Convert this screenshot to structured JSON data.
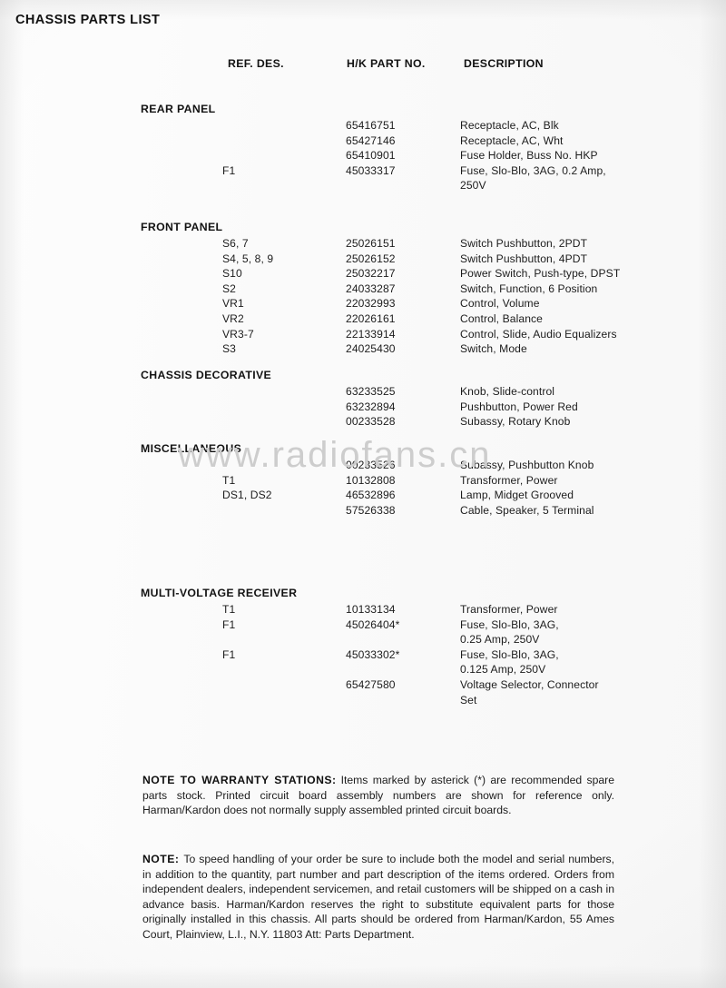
{
  "document": {
    "title": "CHASSIS PARTS LIST",
    "watermark": "www.radiofans.cn"
  },
  "table": {
    "headers": {
      "ref_des": "REF. DES.",
      "part_no": "H/K PART NO.",
      "description": "DESCRIPTION"
    },
    "sections": [
      {
        "name": "REAR PANEL",
        "rows": [
          {
            "ref": "",
            "part": "65416751",
            "desc": "Receptacle, AC, Blk"
          },
          {
            "ref": "",
            "part": "65427146",
            "desc": "Receptacle, AC, Wht"
          },
          {
            "ref": "",
            "part": "65410901",
            "desc": "Fuse Holder, Buss No. HKP"
          },
          {
            "ref": "F1",
            "part": "45033317",
            "desc": "Fuse, Slo-Blo, 3AG, 0.2 Amp,"
          },
          {
            "ref": "",
            "part": "",
            "desc": "250V"
          }
        ]
      },
      {
        "name": "FRONT PANEL",
        "rows": [
          {
            "ref": "S6, 7",
            "part": "25026151",
            "desc": "Switch Pushbutton, 2PDT"
          },
          {
            "ref": "S4, 5, 8, 9",
            "part": "25026152",
            "desc": "Switch Pushbutton, 4PDT"
          },
          {
            "ref": "S10",
            "part": "25032217",
            "desc": "Power Switch, Push-type, DPST"
          },
          {
            "ref": "S2",
            "part": "24033287",
            "desc": "Switch, Function, 6 Position"
          },
          {
            "ref": "VR1",
            "part": "22032993",
            "desc": "Control, Volume"
          },
          {
            "ref": "VR2",
            "part": "22026161",
            "desc": "Control, Balance"
          },
          {
            "ref": "VR3-7",
            "part": "22133914",
            "desc": "Control, Slide, Audio Equalizers"
          },
          {
            "ref": "S3",
            "part": "24025430",
            "desc": "Switch, Mode"
          }
        ]
      },
      {
        "name": "CHASSIS DECORATIVE",
        "rows": [
          {
            "ref": "",
            "part": "63233525",
            "desc": "Knob, Slide-control"
          },
          {
            "ref": "",
            "part": "63232894",
            "desc": "Pushbutton, Power Red"
          },
          {
            "ref": "",
            "part": "00233528",
            "desc": "Subassy, Rotary Knob"
          }
        ]
      },
      {
        "name": "MISCELLANEOUS",
        "rows": [
          {
            "ref": "",
            "part": "00233526",
            "desc": "Subassy, Pushbutton Knob"
          },
          {
            "ref": "T1",
            "part": "10132808",
            "desc": "Transformer, Power"
          },
          {
            "ref": "DS1, DS2",
            "part": "46532896",
            "desc": "Lamp, Midget Grooved"
          },
          {
            "ref": "",
            "part": "57526338",
            "desc": "Cable, Speaker, 5 Terminal"
          }
        ]
      },
      {
        "name": "MULTI-VOLTAGE RECEIVER",
        "rows": [
          {
            "ref": "T1",
            "part": "10133134",
            "desc": "Transformer, Power"
          },
          {
            "ref": "F1",
            "part": "45026404*",
            "desc": "Fuse, Slo-Blo, 3AG,"
          },
          {
            "ref": "",
            "part": "",
            "desc": "0.25 Amp, 250V"
          },
          {
            "ref": "F1",
            "part": "45033302*",
            "desc": "Fuse, Slo-Blo, 3AG,"
          },
          {
            "ref": "",
            "part": "",
            "desc": "0.125 Amp, 250V"
          },
          {
            "ref": "",
            "part": "65427580",
            "desc": "Voltage Selector, Connector"
          },
          {
            "ref": "",
            "part": "",
            "desc": "Set"
          }
        ]
      }
    ]
  },
  "notes": {
    "warranty": {
      "label": "NOTE TO WARRANTY STATIONS:",
      "body": "Items marked by asterick (*) are recommended spare parts stock.  Printed circuit board assembly numbers are shown for reference only.  Harman/Kardon does not normally supply assembled printed circuit boards."
    },
    "ordering": {
      "label": "NOTE:",
      "body": "To speed handling of your order be sure to include both the model and serial numbers, in addition to the quantity, part number and part description of the items ordered.  Orders from independent dealers, independent servicemen, and retail customers will be shipped on a cash in advance basis.  Harman/Kardon reserves the right to substitute equivalent parts for those originally installed in this chassis.  All parts should be ordered from Harman/Kardon, 55 Ames Court, Plainview, L.I., N.Y. 11803 Att: Parts Department."
    }
  }
}
